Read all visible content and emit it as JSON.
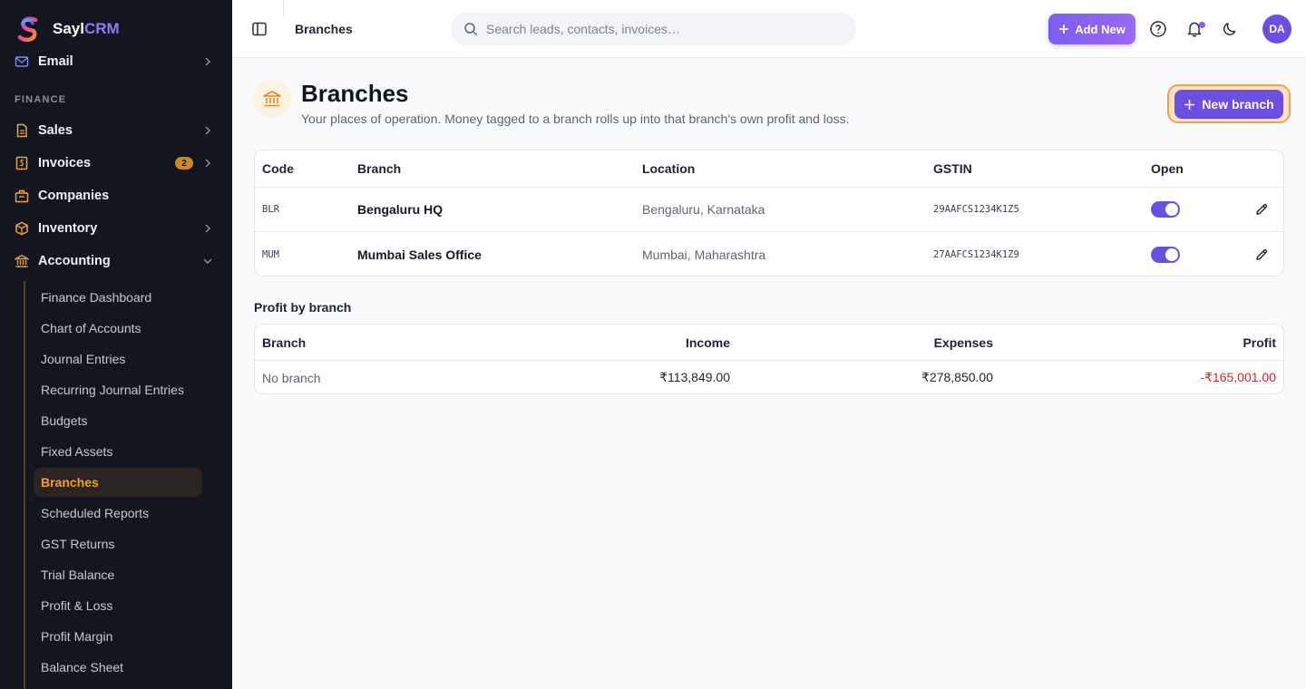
{
  "brand": {
    "name_a": "Sayl",
    "name_b": "CRM"
  },
  "sidebar": {
    "top_item": {
      "label": "Email",
      "icon": "mail-icon"
    },
    "section": "FINANCE",
    "items": [
      {
        "label": "Sales",
        "icon": "file-icon"
      },
      {
        "label": "Invoices",
        "icon": "invoice-icon",
        "badge": "2"
      },
      {
        "label": "Companies",
        "icon": "building-icon"
      },
      {
        "label": "Inventory",
        "icon": "box-icon"
      },
      {
        "label": "Accounting",
        "icon": "bank-icon"
      }
    ],
    "subitems": [
      "Finance Dashboard",
      "Chart of Accounts",
      "Journal Entries",
      "Recurring Journal Entries",
      "Budgets",
      "Fixed Assets",
      "Branches",
      "Scheduled Reports",
      "GST Returns",
      "Trial Balance",
      "Profit & Loss",
      "Profit Margin",
      "Balance Sheet"
    ],
    "active": "Branches"
  },
  "topbar": {
    "breadcrumb": "Branches",
    "search_placeholder": "Search leads, contacts, invoices…",
    "add_new": "Add New",
    "avatar": "DA"
  },
  "page": {
    "title": "Branches",
    "subtitle": "Your places of operation. Money tagged to a branch rolls up into that branch's own profit and loss.",
    "new_branch": "New branch"
  },
  "branches_table": {
    "headers": [
      "Code",
      "Branch",
      "Location",
      "GSTIN",
      "Open"
    ],
    "rows": [
      {
        "code": "BLR",
        "branch": "Bengaluru HQ",
        "location": "Bengaluru, Karnataka",
        "gstin": "29AAFCS1234K1Z5",
        "open": true
      },
      {
        "code": "MUM",
        "branch": "Mumbai Sales Office",
        "location": "Mumbai, Maharashtra",
        "gstin": "27AAFCS1234K1Z9",
        "open": true
      }
    ]
  },
  "profit_section": {
    "title": "Profit by branch",
    "headers": [
      "Branch",
      "Income",
      "Expenses",
      "Profit"
    ],
    "rows": [
      {
        "branch": "No branch",
        "income": "₹113,849.00",
        "expenses": "₹278,850.00",
        "profit": "-₹165,001.00"
      }
    ]
  },
  "colors": {
    "accent": "#6b4fe0",
    "active_nav": "#f59e2f",
    "negative": "#d0262f",
    "sidebar_bg": "#14161f"
  }
}
